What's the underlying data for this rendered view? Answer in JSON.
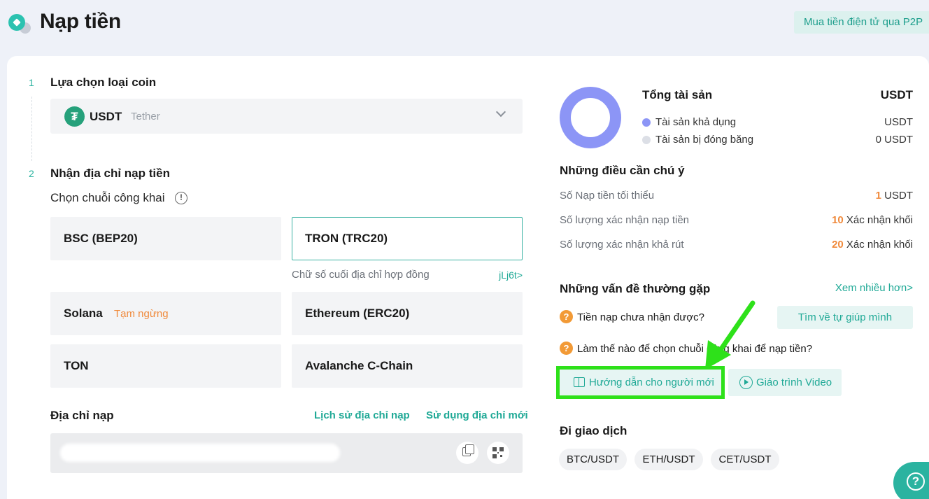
{
  "header": {
    "title": "Nạp tiền",
    "p2p_button": "Mua tiền điện tử qua P2P"
  },
  "steps": {
    "step1": {
      "num": "1",
      "label": "Lựa chọn loại coin"
    },
    "step2": {
      "num": "2",
      "label": "Nhận địa chỉ nạp tiền"
    }
  },
  "coin": {
    "icon": "tether-icon",
    "symbol": "USDT",
    "name": "Tether"
  },
  "chain_section": {
    "label": "Chọn chuỗi công khai",
    "chains": [
      {
        "label": "BSC (BEP20)"
      },
      {
        "label": "TRON (TRC20)",
        "selected": true
      },
      {
        "label": "Solana",
        "status": "Tạm ngừng"
      },
      {
        "label": "Ethereum (ERC20)"
      },
      {
        "label": "TON"
      },
      {
        "label": "Avalanche C-Chain"
      }
    ],
    "contract_label": "Chữ số cuối địa chỉ hợp đồng",
    "contract_link": "jLj6t>"
  },
  "address": {
    "label": "Địa chỉ nạp",
    "history_link": "Lịch sử địa chỉ nạp",
    "new_link": "Sử dụng địa chỉ mới"
  },
  "assets": {
    "title": "Tổng tài sản",
    "currency": "USDT",
    "available_label": "Tài sản khả dụng",
    "available_value": "USDT",
    "frozen_label": "Tài sản bị đóng băng",
    "frozen_value": "0 USDT",
    "available_color": "#8c95f6",
    "frozen_color": "#dcdfe6"
  },
  "notes": {
    "title": "Những điều cần chú ý",
    "min_label": "Số Nạp tiền tối thiểu",
    "min_num": "1",
    "min_unit": "USDT",
    "confirm_label": "Số lượng xác nhận nạp tiền",
    "confirm_num": "10",
    "confirm_unit": "Xác nhận khối",
    "withdraw_label": "Số lượng xác nhận khả rút",
    "withdraw_num": "20",
    "withdraw_unit": "Xác nhận khối"
  },
  "faq": {
    "title": "Những vấn đề thường gặp",
    "more": "Xem nhiều hơn>",
    "q1": "Tiền nạp chưa nhận được?",
    "q2": "Làm thế nào để chọn chuỗi công khai để nạp tiền?",
    "help_button": "Tìm về tự giúp mình",
    "guide_button": "Hướng dẫn cho người mới",
    "video_button": "Giáo trình Video"
  },
  "trade": {
    "title": "Đi giao dịch",
    "pairs": [
      "BTC/USDT",
      "ETH/USDT",
      "CET/USDT"
    ]
  },
  "support": {
    "icon": "help-icon",
    "glyph": "?"
  },
  "colors": {
    "accent": "#1fa996",
    "warning": "#f08a3c",
    "highlight": "#2ee11a"
  }
}
